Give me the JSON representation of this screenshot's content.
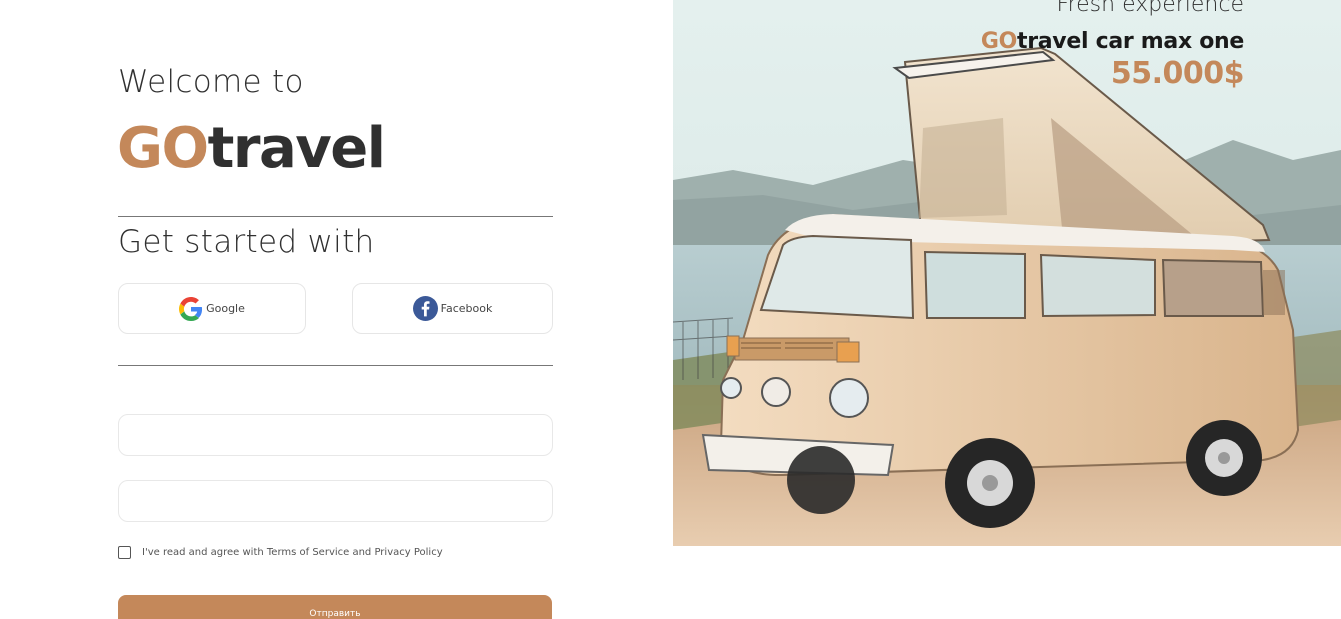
{
  "welcome": {
    "title": "Welcome to",
    "brand_accent": "GO",
    "brand_rest": "travel",
    "subtitle": "Get started with"
  },
  "social": {
    "google_label": "Google",
    "facebook_label": "Facebook"
  },
  "form": {
    "field1_value": "",
    "field2_value": "",
    "agree_text": "I've read and agree with Terms of Service and Privacy Policy",
    "agree_checked": false,
    "submit_label": "Отправить"
  },
  "hero": {
    "tagline": "Fresh experience",
    "model_accent": "GO",
    "model_rest": "travel car max one",
    "price": "55.000$"
  },
  "colors": {
    "accent": "#c4885a",
    "text": "#303030",
    "facebook": "#3b5998"
  },
  "icons": {
    "google": "google-icon",
    "facebook": "facebook-icon",
    "checkbox": "checkbox"
  }
}
